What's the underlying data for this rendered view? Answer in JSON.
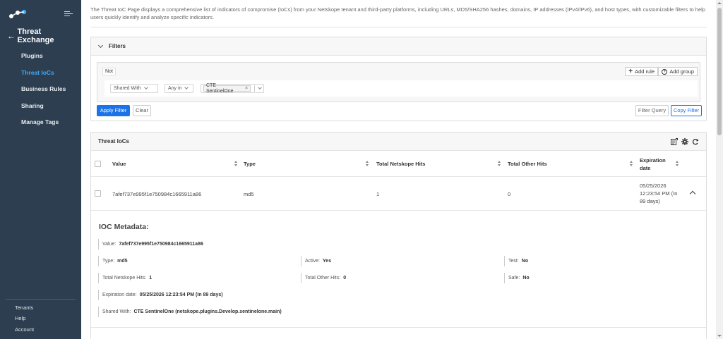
{
  "sidebar": {
    "logo_icon": "netskope-logo-icon",
    "back_icon": "arrow-left-icon",
    "section_title": "Threat Exchange",
    "items": [
      {
        "label": "Plugins",
        "active": false
      },
      {
        "label": "Threat IoCs",
        "active": true
      },
      {
        "label": "Business Rules",
        "active": false
      },
      {
        "label": "Sharing",
        "active": false
      },
      {
        "label": "Manage Tags",
        "active": false
      }
    ],
    "footer": [
      {
        "label": "Tenants"
      },
      {
        "label": "Help"
      },
      {
        "label": "Account"
      }
    ]
  },
  "page": {
    "description": "The Threat IoC Page displays a comprehensive list of indicators of compromise (IoCs) from your Netskope tenant and third-party platforms, including URLs, MD5/SHA256 hashes, domains, IP addresses (IPv4/IPv6), and host types, with customizable filters to help users quickly identify and analyze specific indicators."
  },
  "filters": {
    "title": "Filters",
    "not_label": "Not",
    "add_rule_label": "Add rule",
    "add_group_label": "Add group",
    "field_value": "Shared With",
    "operator_value": "Any in",
    "selected_tag": "CTE SentinelOne",
    "apply_label": "Apply Filter",
    "clear_label": "Clear",
    "filter_query_label": "Filter Query",
    "copy_filter_label": "Copy Filter"
  },
  "iocs": {
    "title": "Threat IoCs",
    "header_icons": [
      "export-icon",
      "gear-icon",
      "refresh-icon"
    ],
    "columns": [
      "Value",
      "Type",
      "Total Netskope Hits",
      "Total Other Hits",
      "Expiration date"
    ],
    "rows": [
      {
        "value": "7afef737e995f1e750984c1665911a86",
        "type": "md5",
        "netskope_hits": "1",
        "other_hits": "0",
        "expiration": "05/25/2026 12:23:54 PM (In 89 days)"
      }
    ]
  },
  "metadata": {
    "title": "IOC Metadata:",
    "value_label": "Value:",
    "value": "7afef737e995f1e750984c1665911a86",
    "type_label": "Type:",
    "type": "md5",
    "active_label": "Active:",
    "active": "Yes",
    "test_label": "Test:",
    "test": "No",
    "netskope_hits_label": "Total Netskope Hits:",
    "netskope_hits": "1",
    "other_hits_label": "Total Other Hits:",
    "other_hits": "0",
    "safe_label": "Safe:",
    "safe": "No",
    "expiration_label": "Expiration date:",
    "expiration": "05/25/2026 12:23:54 PM (In 89 days)",
    "shared_with_label": "Shared With:",
    "shared_with": "CTE SentinelOne (netskope.plugins.Develop.sentinelone.main)"
  },
  "colors": {
    "sidebar_bg": "#2c3e50",
    "accent": "#1a73e8",
    "active_nav": "#3fa9f5"
  }
}
